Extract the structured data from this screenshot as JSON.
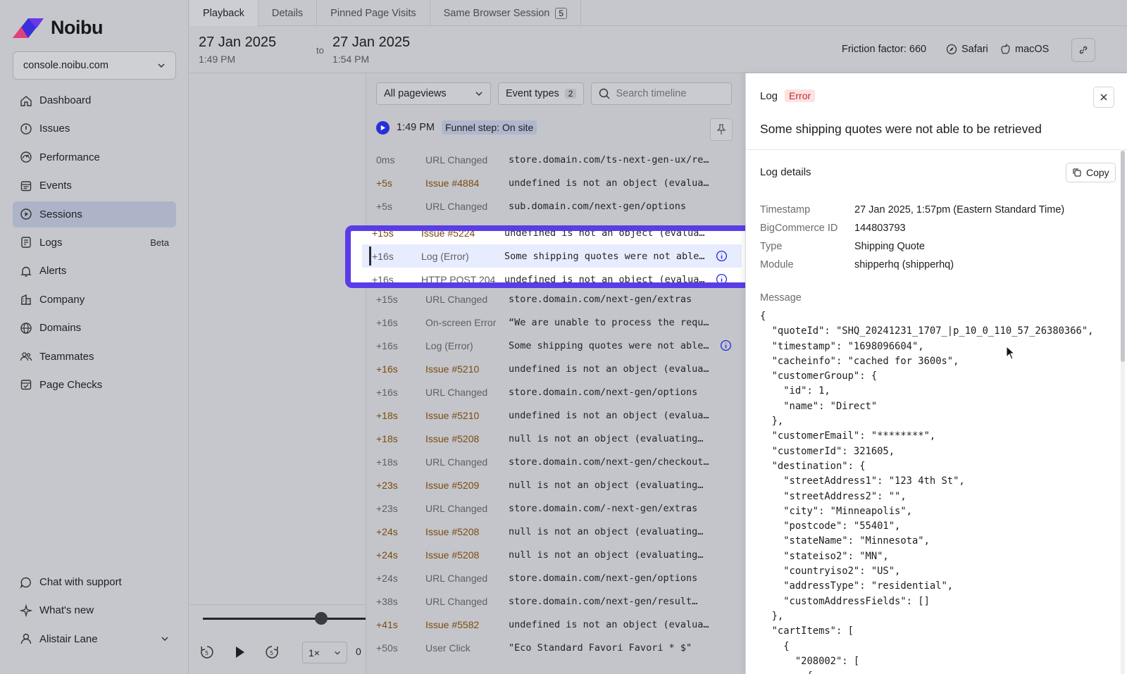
{
  "app": {
    "brand": "Noibu"
  },
  "sidebar": {
    "domain": "console.noibu.com",
    "items": [
      {
        "label": "Dashboard",
        "icon": "home-icon"
      },
      {
        "label": "Issues",
        "icon": "alert-circle-icon"
      },
      {
        "label": "Performance",
        "icon": "gauge-icon"
      },
      {
        "label": "Events",
        "icon": "calendar-list-icon"
      },
      {
        "label": "Sessions",
        "icon": "play-circle-icon",
        "active": true
      },
      {
        "label": "Logs",
        "icon": "log-icon",
        "badge": "Beta"
      },
      {
        "label": "Alerts",
        "icon": "bell-icon"
      },
      {
        "label": "Company",
        "icon": "building-icon"
      },
      {
        "label": "Domains",
        "icon": "globe-icon"
      },
      {
        "label": "Teammates",
        "icon": "users-icon"
      },
      {
        "label": "Page Checks",
        "icon": "page-check-icon"
      }
    ],
    "bottom": [
      {
        "label": "Chat with support",
        "icon": "chat-icon"
      },
      {
        "label": "What's new",
        "icon": "sparkle-icon"
      },
      {
        "label": "Alistair Lane",
        "icon": "user-icon"
      }
    ]
  },
  "tabs": [
    {
      "label": "Playback",
      "active": true
    },
    {
      "label": "Details"
    },
    {
      "label": "Pinned Page Visits"
    },
    {
      "label": "Same Browser Session",
      "count": "5"
    }
  ],
  "session": {
    "start_date": "27 Jan 2025",
    "start_time": "1:49 PM",
    "to": "to",
    "end_date": "27 Jan 2025",
    "end_time": "1:54 PM",
    "friction": "Friction factor: 660",
    "browser": "Safari",
    "os": "macOS"
  },
  "player": {
    "speed": "1×",
    "time_partial": "0"
  },
  "timeline": {
    "pageviews": "All pageviews",
    "event_types": "Event types",
    "event_types_count": "2",
    "search_placeholder": "Search timeline",
    "funnel_time": "1:49 PM",
    "funnel_step": "Funnel step: On site",
    "rows": [
      {
        "time": "0ms",
        "type": "URL Changed",
        "msg": "store.domain.com/ts-next-gen-ux/re…"
      },
      {
        "time": "+5s",
        "type": "Issue #4884",
        "msg": "undefined is not an object (evalua…",
        "issue": true
      },
      {
        "time": "+5s",
        "type": "URL Changed",
        "msg": "sub.domain.com/next-gen/options"
      },
      {
        "time": "+15s",
        "type": "Issue #5224",
        "msg": "undefined is not an object (evalua…",
        "issue": true
      },
      {
        "time": "+16s",
        "type": "Log (Error)",
        "msg": "Some shipping quotes were not able…",
        "info": true
      },
      {
        "time": "+16s",
        "type": "HTTP POST 204",
        "msg": "undefined is not an object (evalua…",
        "info": true
      },
      {
        "time": "+15s",
        "type": "URL Changed",
        "msg": "store.domain.com/next-gen/extras"
      },
      {
        "time": "+16s",
        "type": "On-screen Error",
        "msg": "“We are unable to process the requ…"
      },
      {
        "time": "+16s",
        "type": "Log (Error)",
        "msg": "Some shipping quotes were not able…",
        "info": true
      },
      {
        "time": "+16s",
        "type": "Issue #5210",
        "msg": "undefined is not an object (evalua…",
        "issue": true
      },
      {
        "time": "+16s",
        "type": "URL Changed",
        "msg": "store.domain.com/next-gen/options"
      },
      {
        "time": "+18s",
        "type": "Issue #5210",
        "msg": "undefined is not an object (evalua…",
        "issue": true
      },
      {
        "time": "+18s",
        "type": "Issue #5208",
        "msg": "null is not an object (evaluating…",
        "issue": true
      },
      {
        "time": "+18s",
        "type": "URL Changed",
        "msg": "store.domain.com/next-gen/checkout…"
      },
      {
        "time": "+23s",
        "type": "Issue #5209",
        "msg": "null is not an object (evaluating…",
        "issue": true
      },
      {
        "time": "+23s",
        "type": "URL Changed",
        "msg": "store.domain.com/-next-gen/extras"
      },
      {
        "time": "+24s",
        "type": "Issue #5208",
        "msg": "null is not an object (evaluating…",
        "issue": true
      },
      {
        "time": "+24s",
        "type": "Issue #5208",
        "msg": "null is not an object (evaluating…",
        "issue": true
      },
      {
        "time": "+24s",
        "type": "URL Changed",
        "msg": "store.domain.com/next-gen/options"
      },
      {
        "time": "+38s",
        "type": "URL Changed",
        "msg": "store.domain.com/next-gen/result…"
      },
      {
        "time": "+41s",
        "type": "Issue #5582",
        "msg": "undefined is not an object (evalua…",
        "issue": true
      },
      {
        "time": "+50s",
        "type": "User Click",
        "msg": "\"Eco Standard Favori Favori * $\""
      }
    ]
  },
  "panel": {
    "kind": "Log",
    "badge": "Error",
    "title": "Some shipping quotes were not able to be retrieved",
    "details_label": "Log details",
    "copy_label": "Copy",
    "fields": [
      {
        "k": "Timestamp",
        "v": "27 Jan 2025, 1:57pm (Eastern Standard Time)"
      },
      {
        "k": "BigCommerce ID",
        "v": "144803793"
      },
      {
        "k": "Type",
        "v": "Shipping Quote"
      },
      {
        "k": "Module",
        "v": "shipperhq (shipperhq)"
      }
    ],
    "message_label": "Message",
    "message_lines": [
      "{",
      "  \"quoteId\": \"SHQ_20241231_1707_|p_10_0_110_57_26380366\",",
      "  \"timestamp\": \"1698096604\",",
      "  \"cacheinfo\": \"cached for 3600s\",",
      "  \"customerGroup\": {",
      "    \"id\": 1,",
      "    \"name\": \"Direct\"",
      "  },",
      "  \"customerEmail\": \"********\",",
      "  \"customerId\": 321605,",
      "  \"destination\": {",
      "    \"streetAddress1\": \"123 4th St\",",
      "    \"streetAddress2\": \"\",",
      "    \"city\": \"Minneapolis\",",
      "    \"postcode\": \"55401\",",
      "    \"stateName\": \"Minnesota\",",
      "    \"stateiso2\": \"MN\",",
      "    \"countryiso2\": \"US\",",
      "    \"addressType\": \"residential\",",
      "    \"customAddressFields\": []",
      "  },",
      "  \"cartItems\": [",
      "    {",
      "      \"208002\": [",
      "        {"
    ]
  },
  "colors": {
    "accent": "#5a3de6",
    "brand": "#3b2fd9",
    "error": "#c22d2d",
    "issue": "#7a4b10"
  }
}
